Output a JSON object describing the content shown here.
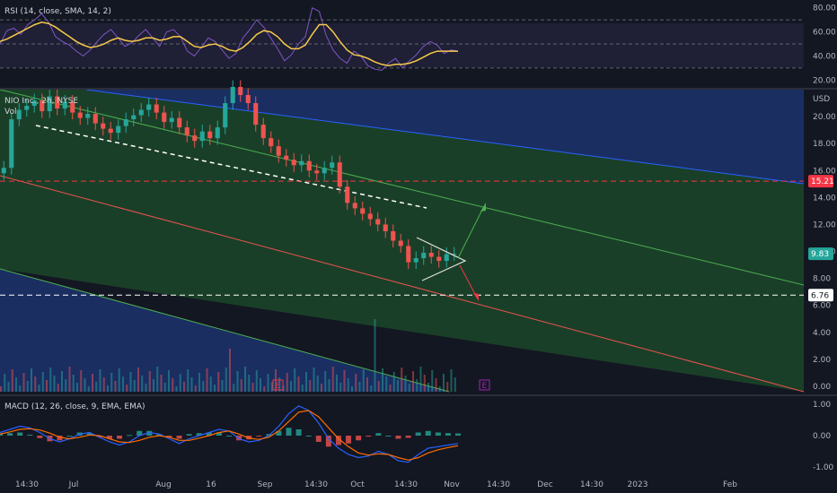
{
  "chart_data": [
    {
      "type": "line",
      "title": "RSI (14, close, SMA, 14, 2)",
      "y_ticks": [
        "80.00",
        "60.00",
        "40.00",
        "20.00"
      ],
      "ylim": [
        15,
        85
      ],
      "levels": [
        70,
        50,
        30
      ],
      "series": [
        {
          "color": "#7e57c2",
          "values": [
            50,
            61,
            63,
            58,
            66,
            70,
            75,
            68,
            56,
            52,
            49,
            44,
            40,
            45,
            52,
            58,
            62,
            55,
            48,
            51,
            57,
            62,
            55,
            48,
            60,
            62,
            56,
            44,
            40,
            47,
            55,
            52,
            45,
            38,
            42,
            55,
            62,
            70,
            64,
            55,
            46,
            36,
            41,
            50,
            56,
            80,
            77,
            57,
            45,
            38,
            34,
            44,
            40,
            32,
            29,
            28,
            34,
            38,
            30,
            36,
            41,
            48,
            52,
            49,
            42,
            45,
            44
          ]
        },
        {
          "color": "#f7c948",
          "values": [
            52,
            54,
            57,
            60,
            63,
            66,
            68,
            67,
            64,
            60,
            56,
            52,
            49,
            47,
            48,
            50,
            53,
            55,
            53,
            52,
            53,
            55,
            55,
            53,
            54,
            56,
            56,
            52,
            48,
            47,
            49,
            50,
            48,
            45,
            44,
            47,
            52,
            58,
            61,
            60,
            56,
            50,
            46,
            46,
            49,
            58,
            66,
            66,
            60,
            52,
            45,
            41,
            40,
            38,
            35,
            33,
            32,
            33,
            33,
            34,
            36,
            39,
            42,
            44,
            44,
            44,
            44
          ]
        }
      ]
    },
    {
      "type": "line",
      "title": "NIO Inc., 2h, NYSE",
      "legend": "Vol",
      "currency": "USD",
      "y_ticks": [
        "20.00",
        "18.00",
        "16.00",
        "14.00",
        "12.00",
        "10.00",
        "8.00",
        "6.00",
        "4.00",
        "2.00",
        "0.00"
      ],
      "ylim": [
        -0.4,
        22
      ],
      "x_ticks": [
        "14:30",
        "Jul",
        "Aug",
        "16",
        "Sep",
        "14:30",
        "Oct",
        "14:30",
        "Nov",
        "14:30",
        "Dec",
        "14:30",
        "2023",
        "Feb"
      ],
      "price_labels": [
        {
          "text": "15.21",
          "color": "#f23645"
        },
        {
          "text": "9.83",
          "color": "#26a69a"
        },
        {
          "text": "6.76",
          "color": "#ffffff"
        }
      ],
      "price_levels": [
        15.21,
        6.76
      ],
      "close": [
        16.2,
        19.8,
        20.5,
        20.8,
        21.2,
        20.4,
        21.5,
        20.6,
        21.1,
        20.3,
        19.9,
        20.2,
        19.5,
        19.1,
        18.8,
        19.3,
        19.8,
        20.1,
        20.5,
        20.9,
        20.3,
        19.6,
        19.9,
        19.2,
        18.6,
        18.2,
        18.9,
        18.4,
        19.2,
        21.0,
        22.2,
        21.6,
        21.0,
        19.4,
        18.4,
        17.8,
        17.1,
        16.8,
        16.4,
        16.7,
        16.0,
        15.8,
        16.2,
        16.6,
        14.8,
        13.6,
        13.2,
        12.8,
        12.4,
        12.0,
        11.5,
        10.8,
        10.4,
        9.2,
        9.5,
        9.9,
        9.6,
        9.3,
        9.8,
        9.83
      ],
      "volume_label_ticks": [
        "4.00",
        "2.00",
        "0.00"
      ],
      "event_markers": [
        "E",
        "E"
      ],
      "drawings": {
        "upper_channel": "blue",
        "middle_channel": "green",
        "lower_channel": "blue",
        "triangle": "white",
        "arrows": [
          "up-green",
          "down-red"
        ]
      }
    },
    {
      "type": "bar",
      "title": "MACD (12, 26, close, 9, EMA, EMA)",
      "y_ticks": [
        "1.00",
        "0.00",
        "-1.00"
      ],
      "ylim": [
        -1.2,
        1.2
      ],
      "series": [
        {
          "name": "MACD",
          "color": "#2962ff",
          "values": [
            0.1,
            0.2,
            0.3,
            0.25,
            0.1,
            -0.1,
            -0.2,
            -0.1,
            0.05,
            0.1,
            -0.05,
            -0.2,
            -0.3,
            -0.2,
            0.0,
            0.1,
            0.05,
            -0.1,
            -0.25,
            -0.1,
            0.0,
            0.1,
            0.2,
            0.15,
            -0.1,
            -0.2,
            -0.15,
            0.0,
            0.3,
            0.7,
            0.95,
            0.8,
            0.4,
            -0.1,
            -0.4,
            -0.6,
            -0.7,
            -0.65,
            -0.5,
            -0.6,
            -0.8,
            -0.85,
            -0.6,
            -0.4,
            -0.35,
            -0.3,
            -0.25
          ]
        },
        {
          "name": "Signal",
          "color": "#ff6d00",
          "values": [
            0.05,
            0.12,
            0.2,
            0.22,
            0.18,
            0.08,
            -0.05,
            -0.1,
            -0.05,
            0.02,
            0.0,
            -0.1,
            -0.2,
            -0.22,
            -0.15,
            -0.05,
            0.0,
            -0.05,
            -0.15,
            -0.15,
            -0.08,
            0.0,
            0.1,
            0.15,
            0.05,
            -0.08,
            -0.12,
            -0.05,
            0.15,
            0.45,
            0.75,
            0.8,
            0.6,
            0.25,
            -0.1,
            -0.35,
            -0.55,
            -0.62,
            -0.58,
            -0.6,
            -0.7,
            -0.78,
            -0.7,
            -0.55,
            -0.45,
            -0.38,
            -0.32
          ]
        }
      ]
    }
  ]
}
